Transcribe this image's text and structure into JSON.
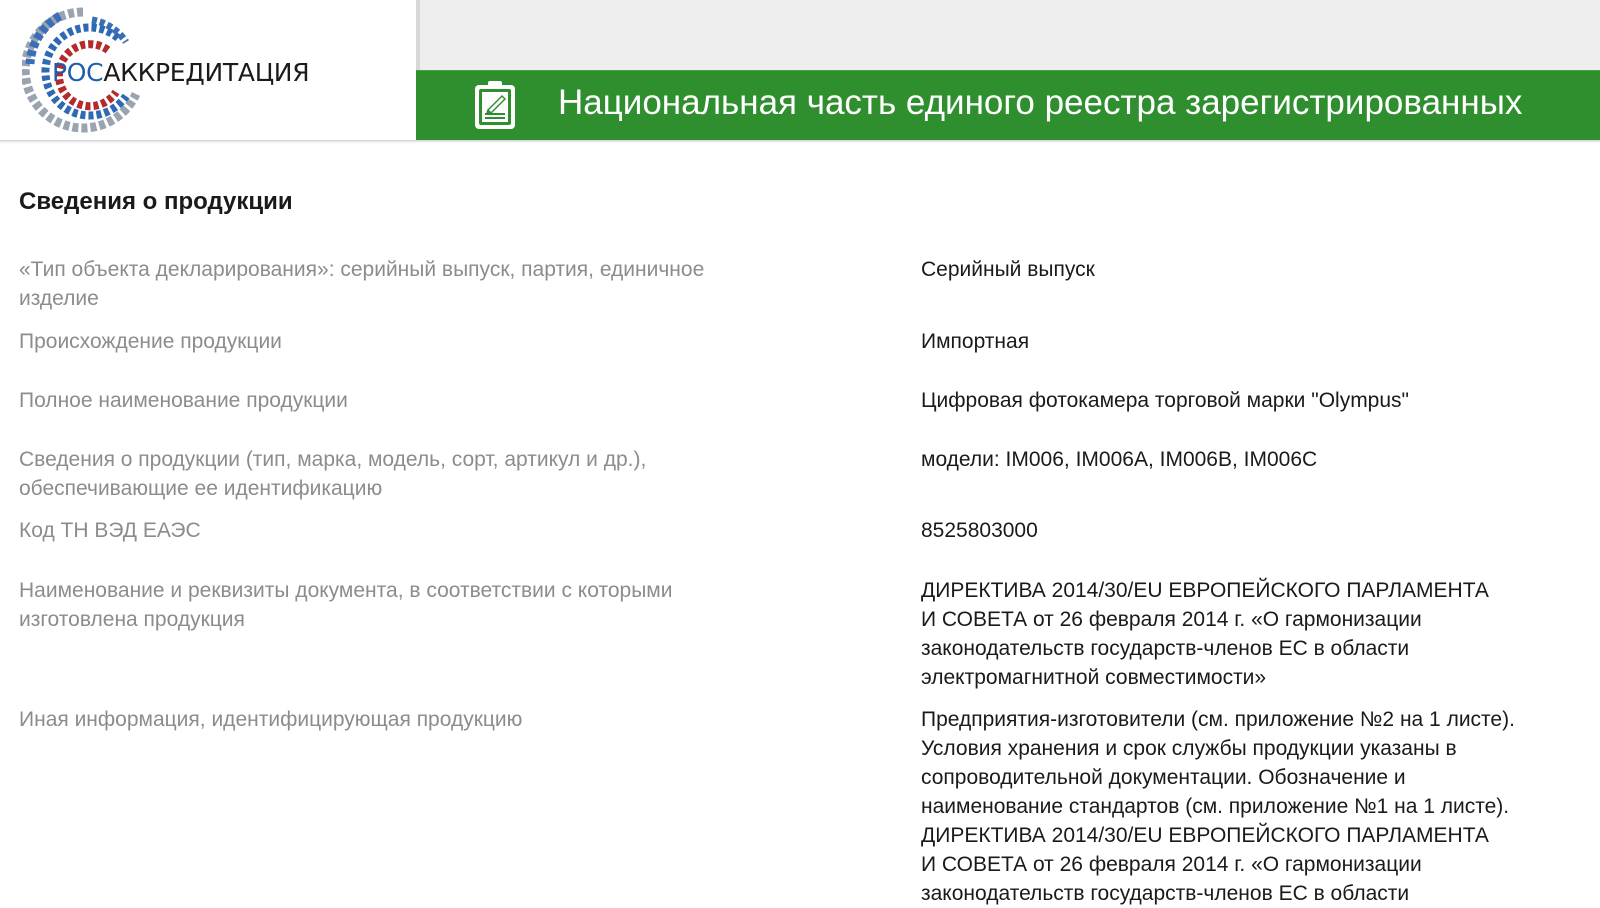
{
  "header": {
    "logo": {
      "prefix": "РОС",
      "suffix": "АККРЕДИТАЦИЯ"
    },
    "title": "Национальная часть единого реестра зарегистрированных",
    "icon": "document-edit-icon",
    "colors": {
      "green": "#2f8f2f",
      "logo_blue": "#1e5fa8",
      "logo_red": "#b52b2b"
    }
  },
  "section": {
    "title": "Сведения о продукции",
    "fields": [
      {
        "label": "«Тип объекта декларирования»: серийный выпуск, партия, единичное изделие",
        "value": [
          "Серийный выпуск"
        ]
      },
      {
        "label": "Происхождение продукции",
        "value": [
          "Импортная"
        ]
      },
      {
        "label": "Полное наименование продукции",
        "value": [
          "Цифровая фотокамера торговой марки \"Olympus\""
        ]
      },
      {
        "label": "Сведения о продукции (тип, марка, модель, сорт, артикул и др.), обеспечивающие ее идентификацию",
        "value": [
          "модели: IM006, IM006A, IM006B, IM006C"
        ]
      },
      {
        "label": "Код ТН ВЭД ЕАЭС",
        "value": [
          "8525803000"
        ]
      },
      {
        "label": "Наименование и реквизиты документа, в соответствии с которыми изготовлена продукция",
        "value": [
          "ДИРЕКТИВА 2014/30/EU ЕВРОПЕЙСКОГО ПАРЛАМЕНТА",
          "И СОВЕТА от 26 февраля 2014 г. «О гармонизации",
          "законодательств государств-членов ЕС в области",
          "электромагнитной совместимости»"
        ]
      },
      {
        "label": "Иная информация, идентифицирующая продукцию",
        "value": [
          "Предприятия-изготовители (см. приложение №2 на 1 листе).",
          "Условия хранения и срок службы продукции указаны в",
          "сопроводительной документации. Обозначение и",
          "наименование стандартов (см. приложение №1 на 1 листе).",
          "ДИРЕКТИВА 2014/30/EU ЕВРОПЕЙСКОГО ПАРЛАМЕНТА",
          "И СОВЕТА от 26 февраля 2014 г. «О гармонизации",
          "законодательств государств-членов ЕС в области"
        ]
      }
    ]
  }
}
